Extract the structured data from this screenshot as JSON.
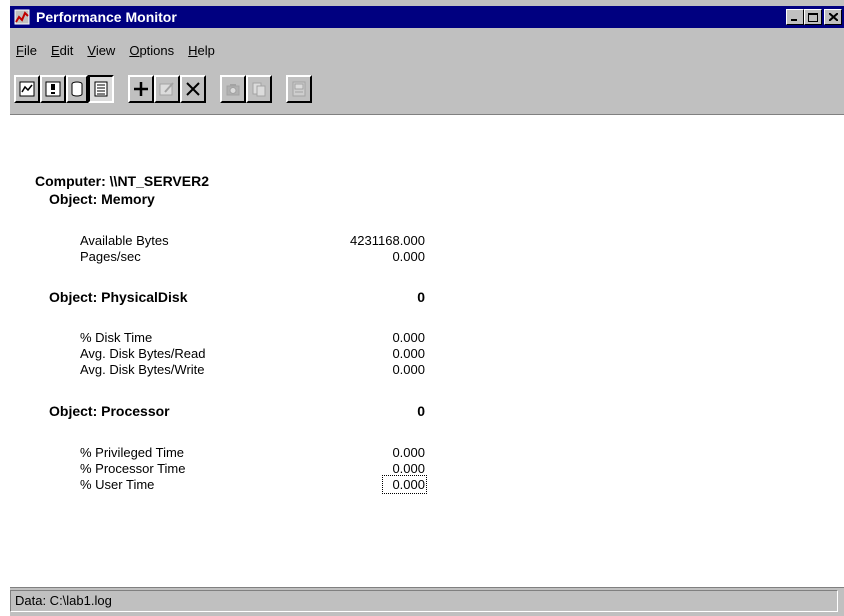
{
  "window": {
    "title": "Performance Monitor"
  },
  "menu": [
    "File",
    "Edit",
    "View",
    "Options",
    "Help"
  ],
  "toolbar": {
    "buttons": [
      {
        "icon": "chart-view-icon"
      },
      {
        "icon": "alert-view-icon"
      },
      {
        "icon": "log-view-icon"
      },
      {
        "icon": "report-view-icon"
      },
      {
        "icon": "add-counter-icon"
      },
      {
        "icon": "edit-counter-icon"
      },
      {
        "icon": "delete-counter-icon"
      },
      {
        "icon": "update-data-icon"
      },
      {
        "icon": "bookmark-icon"
      },
      {
        "icon": "options-icon"
      }
    ]
  },
  "report": {
    "computer": "Computer: \\\\NT_SERVER2",
    "memory": {
      "header": "Object: Memory",
      "counters": [
        {
          "name": "Available Bytes",
          "value": "4231168.000"
        },
        {
          "name": "Pages/sec",
          "value": "0.000"
        }
      ]
    },
    "disk": {
      "header": "Object: PhysicalDisk",
      "instance": "0",
      "counters": [
        {
          "name": "% Disk Time",
          "value": "0.000"
        },
        {
          "name": "Avg. Disk Bytes/Read",
          "value": "0.000"
        },
        {
          "name": "Avg. Disk Bytes/Write",
          "value": "0.000"
        }
      ]
    },
    "processor": {
      "header": "Object: Processor",
      "instance": "0",
      "counters": [
        {
          "name": "% Privileged Time",
          "value": "0.000"
        },
        {
          "name": "% Processor Time",
          "value": "0.000"
        },
        {
          "name": "% User Time",
          "value": "0.000"
        }
      ]
    }
  },
  "status": {
    "text": "Data: C:\\lab1.log"
  }
}
